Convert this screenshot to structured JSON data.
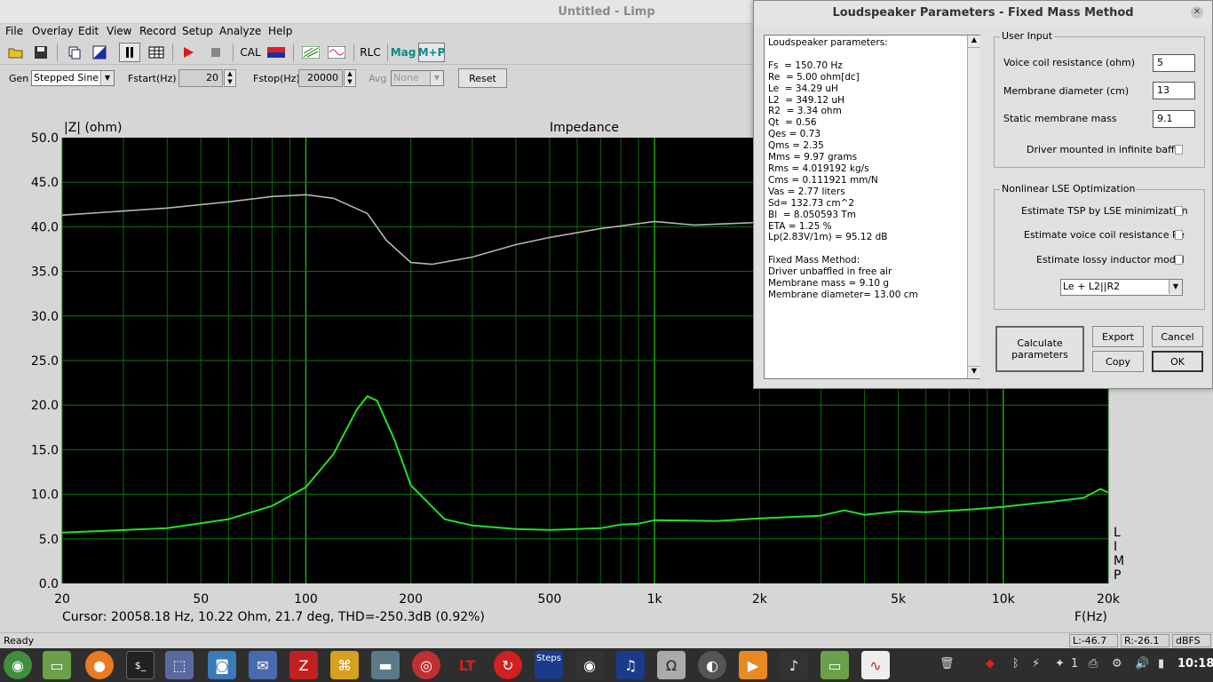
{
  "window": {
    "title": "Untitled - Limp"
  },
  "menu": [
    "File",
    "Overlay",
    "Edit",
    "View",
    "Record",
    "Setup",
    "Analyze",
    "Help"
  ],
  "toolbar": {
    "cal": "CAL",
    "rlc": "RLC",
    "mag": "Mag",
    "mp": "M+P"
  },
  "gen": {
    "gen_label": "Gen",
    "gen_value": "Stepped Sine",
    "fstart_label": "Fstart(Hz)",
    "fstart_value": "20",
    "fstop_label": "Fstop(Hz)",
    "fstop_value": "20000",
    "avg_label": "Avg",
    "avg_value": "None",
    "reset_label": "Reset"
  },
  "plot": {
    "ylabel": "|Z| (ohm)",
    "title": "Impedance",
    "xlabel": "F(Hz)",
    "cursor": "Cursor: 20058.18 Hz, 10.22 Ohm, 21.7 deg, THD=-250.3dB (0.92%)",
    "watermark": [
      "L",
      "I",
      "M",
      "P"
    ],
    "yticks": [
      "50.0",
      "45.0",
      "40.0",
      "35.0",
      "30.0",
      "25.0",
      "20.0",
      "15.0",
      "10.0",
      "5.0",
      "0.0"
    ],
    "xticks": [
      "20",
      "50",
      "100",
      "200",
      "500",
      "1k",
      "2k",
      "5k",
      "10k",
      "20k"
    ]
  },
  "chart_data": {
    "type": "line",
    "xscale": "log",
    "xlim": [
      20,
      20000
    ],
    "ylim": [
      0,
      50
    ],
    "grid": true,
    "series": [
      {
        "color": "#24e024",
        "points": [
          [
            20,
            5.7
          ],
          [
            40,
            6.2
          ],
          [
            60,
            7.2
          ],
          [
            80,
            8.7
          ],
          [
            100,
            10.8
          ],
          [
            120,
            14.5
          ],
          [
            140,
            19.5
          ],
          [
            150,
            21.0
          ],
          [
            160,
            20.5
          ],
          [
            180,
            16
          ],
          [
            200,
            11
          ],
          [
            250,
            7.2
          ],
          [
            300,
            6.5
          ],
          [
            400,
            6.1
          ],
          [
            500,
            6.0
          ],
          [
            700,
            6.2
          ],
          [
            800,
            6.6
          ],
          [
            900,
            6.7
          ],
          [
            1000,
            7.1
          ],
          [
            1500,
            7.0
          ],
          [
            2000,
            7.3
          ],
          [
            3000,
            7.6
          ],
          [
            3500,
            8.2
          ],
          [
            4000,
            7.7
          ],
          [
            5000,
            8.1
          ],
          [
            6000,
            8.0
          ],
          [
            8000,
            8.3
          ],
          [
            10000,
            8.6
          ],
          [
            14000,
            9.2
          ],
          [
            17000,
            9.6
          ],
          [
            19000,
            10.6
          ],
          [
            20000,
            10.2
          ]
        ]
      },
      {
        "color": "#b4b4b4",
        "points": [
          [
            20,
            41.3
          ],
          [
            40,
            42.1
          ],
          [
            60,
            42.8
          ],
          [
            80,
            43.4
          ],
          [
            100,
            43.6
          ],
          [
            120,
            43.2
          ],
          [
            150,
            41.5
          ],
          [
            170,
            38.5
          ],
          [
            200,
            36.0
          ],
          [
            230,
            35.8
          ],
          [
            300,
            36.6
          ],
          [
            400,
            38.0
          ],
          [
            500,
            38.8
          ],
          [
            700,
            39.8
          ],
          [
            1000,
            40.6
          ],
          [
            1300,
            40.2
          ],
          [
            2000,
            40.5
          ],
          [
            2400,
            40.8
          ]
        ]
      }
    ]
  },
  "status": {
    "ready": "Ready",
    "left": "L:-46.7",
    "right": "R:-26.1",
    "unit": "dBFS"
  },
  "dialog": {
    "title": "Loudspeaker Parameters - Fixed Mass Method",
    "results": "Loudspeaker parameters:\n\nFs  = 150.70 Hz\nRe  = 5.00 ohm[dc]\nLe  = 34.29 uH\nL2  = 349.12 uH\nR2  = 3.34 ohm\nQt  = 0.56\nQes = 0.73\nQms = 2.35\nMms = 9.97 grams\nRms = 4.019192 kg/s\nCms = 0.111921 mm/N\nVas = 2.77 liters\nSd= 132.73 cm^2\nBl  = 8.050593 Tm\nETA = 1.25 %\nLp(2.83V/1m) = 95.12 dB\n\nFixed Mass Method:\nDriver unbaffled in free air\nMembrane mass = 9.10 g\nMembrane diameter= 13.00 cm",
    "user_input": {
      "title": "User Input",
      "vc_label": "Voice coil resistance (ohm)",
      "vc_value": "5",
      "md_label": "Membrane diameter (cm)",
      "md_value": "13",
      "sm_label": "Static membrane mass",
      "sm_value": "9.1",
      "baffle_label": "Driver mounted in infinite baffle"
    },
    "nonlinear": {
      "title": "Nonlinear LSE Optimization",
      "tsp_label": "Estimate TSP by LSE minimization",
      "vcr_label": "Estimate voice coil resistance Re",
      "lossy_label": "Estimate lossy inductor model",
      "model_value": "Le + L2||R2"
    },
    "buttons": {
      "calc": "Calculate parameters",
      "export": "Export",
      "cancel": "Cancel",
      "copy": "Copy",
      "ok": "OK"
    }
  },
  "taskbar": {
    "time": "10:18",
    "workspace": "1",
    "steps": "Steps"
  }
}
